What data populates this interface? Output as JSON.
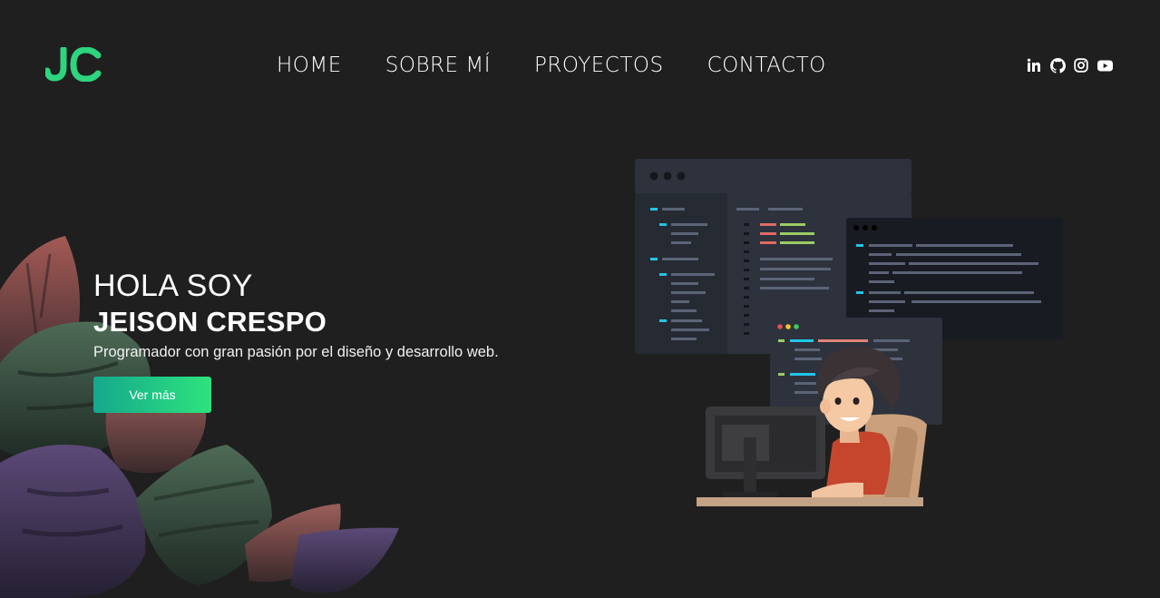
{
  "brand": {
    "logo_text": "JC",
    "accent": "#2ed47e"
  },
  "nav": {
    "items": [
      {
        "label": "HOME"
      },
      {
        "label": "SOBRE MÍ"
      },
      {
        "label": "PROYECTOS"
      },
      {
        "label": "CONTACTO"
      }
    ]
  },
  "social": {
    "icons": [
      "linkedin-icon",
      "github-icon",
      "instagram-icon",
      "youtube-icon"
    ]
  },
  "hero": {
    "greeting": "HOLA SOY",
    "name": "JEISON CRESPO",
    "subtitle": "Programador con gran pasión por el diseño y desarrollo web.",
    "cta_label": "Ver más"
  },
  "colors": {
    "background": "#1f1f1f",
    "button_start": "#15a88c",
    "button_end": "#2de37e"
  }
}
